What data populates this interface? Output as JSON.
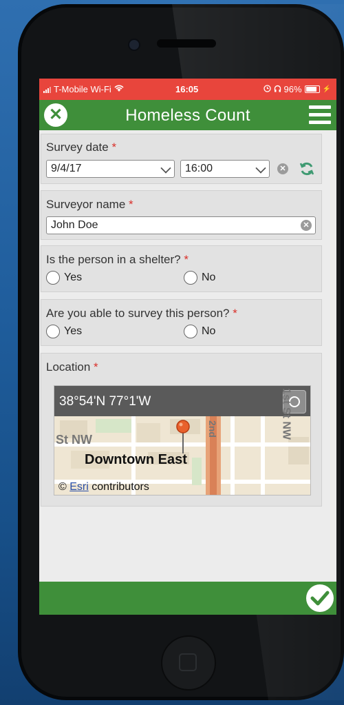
{
  "status_bar": {
    "carrier": "T-Mobile Wi-Fi",
    "time": "16:05",
    "battery": "96%"
  },
  "app_bar": {
    "title": "Homeless Count"
  },
  "form": {
    "survey_date": {
      "label": "Survey date",
      "required_mark": "*",
      "date_value": "9/4/17",
      "time_value": "16:00"
    },
    "surveyor_name": {
      "label": "Surveyor name",
      "required_mark": "*",
      "value": "John Doe"
    },
    "in_shelter": {
      "question": "Is the person in a shelter?",
      "required_mark": "*",
      "options": [
        "Yes",
        "No"
      ]
    },
    "able_to_survey": {
      "question": "Are you able to survey this person?",
      "required_mark": "*",
      "options": [
        "Yes",
        "No"
      ]
    },
    "location": {
      "label": "Location",
      "required_mark": "*",
      "coordinates": "38°54'N 77°1'W",
      "map_labels": {
        "area": "Downtown East",
        "street_left": "St NW",
        "street_right": "1st St NW",
        "street_top": "2nd"
      },
      "attribution": {
        "copyright": "©",
        "link": "Esri",
        "suffix": "contributors"
      }
    }
  },
  "colors": {
    "accent_green": "#3f8f3a",
    "status_red": "#e8453c",
    "required_red": "#d9302a"
  },
  "icons": {
    "close": "close-icon",
    "menu": "hamburger-menu-icon",
    "submit": "checkmark-icon",
    "refresh": "refresh-icon",
    "locate": "crosshair-icon"
  }
}
